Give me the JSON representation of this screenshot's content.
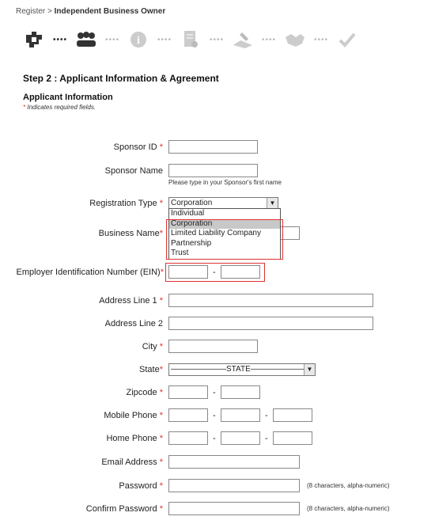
{
  "breadcrumb": {
    "root": "Register",
    "separator": " > ",
    "current": "Independent Business Owner"
  },
  "progress": {
    "icons": [
      "puzzle-icon",
      "people-icon",
      "info-icon",
      "document-icon",
      "signature-icon",
      "handshake-icon",
      "checkmark-icon"
    ],
    "dots": "••••"
  },
  "step_title": "Step 2 : Applicant Information & Agreement",
  "section_title": "Applicant Information",
  "required_note": {
    "star": "*",
    "text": "Indicates required fields."
  },
  "form": {
    "required_star": "*",
    "sponsor_id_label": "Sponsor ID",
    "sponsor_name_label": "Sponsor Name",
    "sponsor_name_hint": "Please type in your Sponsor's first name",
    "registration_type_label": "Registration Type",
    "registration_type_value": "Corporation",
    "registration_type_options": [
      "Individual",
      "Corporation",
      "Limited Liability Company",
      "Partnership",
      "Trust"
    ],
    "business_name_label": "Business Name",
    "ein_label": "Employer Identification Number (EIN)",
    "dash": "-",
    "address1_label": "Address Line 1",
    "address2_label": "Address Line 2",
    "city_label": "City",
    "state_label": "State",
    "state_value": "———————STATE———————",
    "zipcode_label": "Zipcode",
    "mobile_label": "Mobile Phone",
    "home_label": "Home Phone",
    "email_label": "Email Address",
    "password_label": "Password",
    "password_hint": "(8 characters, alpha-numeric)",
    "confirm_password_label": "Confirm Password",
    "confirm_password_hint": "(8 characters, alpha-numeric)"
  }
}
